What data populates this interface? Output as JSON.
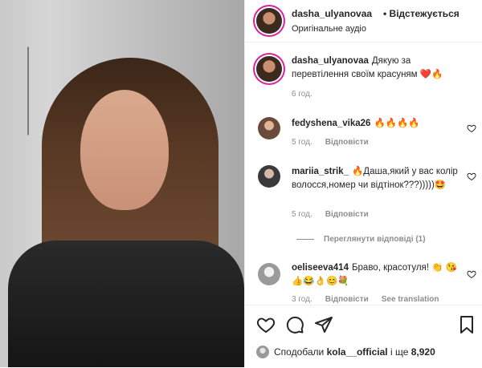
{
  "video": {},
  "header": {
    "username": "dasha_ulyanovaa",
    "follow_label": "• Відстежується",
    "subtitle": "Оригінальне аудіо",
    "more_icon": "•••"
  },
  "caption": {
    "username": "dasha_ulyanovaa",
    "text": "Дякую за перевтілення своїм красуням ❤️🔥",
    "time": "6 год."
  },
  "comments": [
    {
      "username": "fedyshena_vika26",
      "text": "🔥🔥🔥🔥",
      "time": "5 год.",
      "reply_label": "Відповісти"
    },
    {
      "username": "mariia_strik_",
      "text": "🔥Даша,який у вас колір волосся,номер чи відтінок???)))))🤩",
      "time": "5 год.",
      "reply_label": "Відповісти"
    },
    {
      "username": "oeliseeva414",
      "text": "Браво, красотуля! 👏 😘👍😂👌😊💐",
      "time": "3 год.",
      "reply_label": "Відповісти",
      "extra_label": "See translation"
    }
  ],
  "view_replies": "Переглянути відповіді (1)",
  "actions": {
    "like_icon": "heart-outline-icon",
    "comment_icon": "comment-bubble-icon",
    "share_icon": "paper-plane-icon",
    "save_icon": "bookmark-icon"
  },
  "likes": {
    "prefix": "Сподобали",
    "user": "kola__official",
    "connector": "і ще",
    "count": "8,920"
  }
}
